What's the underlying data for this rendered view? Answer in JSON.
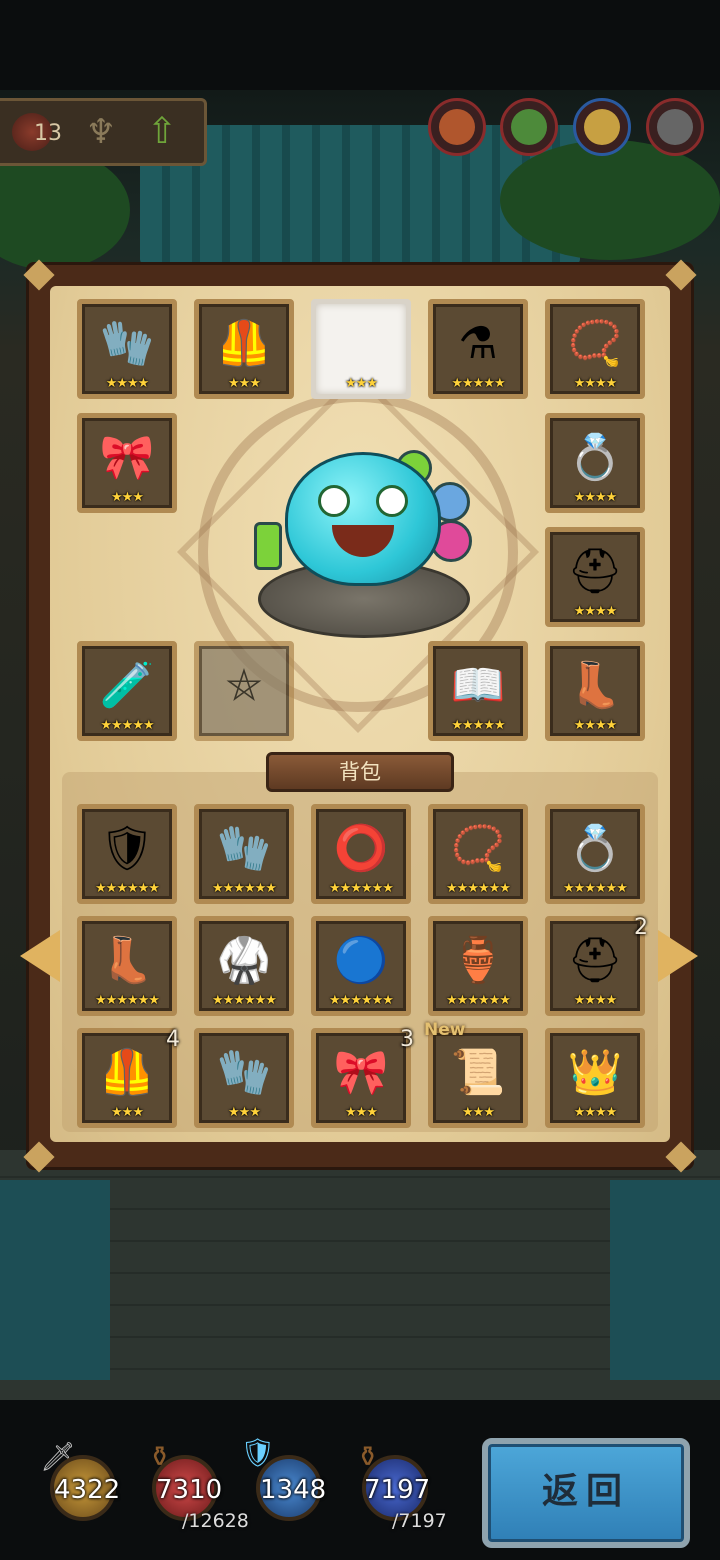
{
  "header": {
    "level": "13",
    "portraits": [
      {
        "name": "character-portrait",
        "color": "#b0562d"
      },
      {
        "name": "goblin-portrait",
        "color": "#4d8a3a"
      },
      {
        "name": "hero-portrait",
        "color": "#c7a042"
      },
      {
        "name": "dark-knight-portrait",
        "color": "#666666"
      }
    ]
  },
  "equipped": [
    {
      "icon": "bracer",
      "glyph": "🧤",
      "stars": "★★★★"
    },
    {
      "icon": "armor",
      "glyph": "🦺",
      "stars": "★★★"
    },
    {
      "icon": "empty",
      "glyph": "",
      "stars": "★★★"
    },
    {
      "icon": "cauldron",
      "glyph": "⚗",
      "stars": "★★★★★"
    },
    {
      "icon": "necklace",
      "glyph": "📿",
      "stars": "★★★★"
    },
    {
      "icon": "belt",
      "glyph": "🎀",
      "stars": "★★★"
    },
    {
      "icon": "ring",
      "glyph": "💍",
      "stars": "★★★★"
    },
    {
      "icon": "helmet",
      "glyph": "⛑",
      "stars": "★★★★"
    },
    {
      "icon": "potion-stand",
      "glyph": "🧪",
      "stars": "★★★★★"
    },
    {
      "icon": "ghost-slot",
      "glyph": "⛤",
      "stars": ""
    },
    {
      "icon": "book",
      "glyph": "📖",
      "stars": "★★★★★"
    },
    {
      "icon": "boots",
      "glyph": "👢",
      "stars": "★★★★"
    }
  ],
  "bag": {
    "title": "背包",
    "items": [
      {
        "icon": "silver-armor",
        "glyph": "🛡",
        "stars": "★★★★★★",
        "count": ""
      },
      {
        "icon": "gold-gauntlet",
        "glyph": "🧤",
        "stars": "★★★★★★",
        "count": ""
      },
      {
        "icon": "green-belt",
        "glyph": "⭕",
        "stars": "★★★★★★",
        "count": ""
      },
      {
        "icon": "flower-necklace",
        "glyph": "📿",
        "stars": "★★★★★★",
        "count": ""
      },
      {
        "icon": "blue-ring",
        "glyph": "💍",
        "stars": "★★★★★★",
        "count": ""
      },
      {
        "icon": "red-boots",
        "glyph": "👢",
        "stars": "★★★★★★",
        "count": ""
      },
      {
        "icon": "teal-armor",
        "glyph": "🥋",
        "stars": "★★★★★★",
        "count": ""
      },
      {
        "icon": "blue-orb",
        "glyph": "🔵",
        "stars": "★★★★★★",
        "count": ""
      },
      {
        "icon": "gold-armor",
        "glyph": "🏺",
        "stars": "★★★★★★",
        "count": ""
      },
      {
        "icon": "red-helmet",
        "glyph": "⛑",
        "stars": "★★★★",
        "count": "2"
      },
      {
        "icon": "red-armor",
        "glyph": "🦺",
        "stars": "★★★",
        "count": "4"
      },
      {
        "icon": "bracer",
        "glyph": "🧤",
        "stars": "★★★",
        "count": ""
      },
      {
        "icon": "belt",
        "glyph": "🎀",
        "stars": "★★★",
        "count": "3"
      },
      {
        "icon": "scroll-rune",
        "glyph": "📜",
        "stars": "★★★",
        "count": ""
      },
      {
        "icon": "gold-crown-helm",
        "glyph": "👑",
        "stars": "★★★★",
        "count": ""
      }
    ],
    "new_label": "New"
  },
  "resources": {
    "attack": {
      "value": "4322",
      "color": "#b88a2a"
    },
    "hp": {
      "value": "7310",
      "max": "/12628",
      "color": "#b02a2a"
    },
    "defense": {
      "value": "1348",
      "color": "#2a6ab0"
    },
    "mp": {
      "value": "7197",
      "max": "/7197",
      "color": "#2a4aa0"
    }
  },
  "back_button": {
    "label": "返回"
  }
}
